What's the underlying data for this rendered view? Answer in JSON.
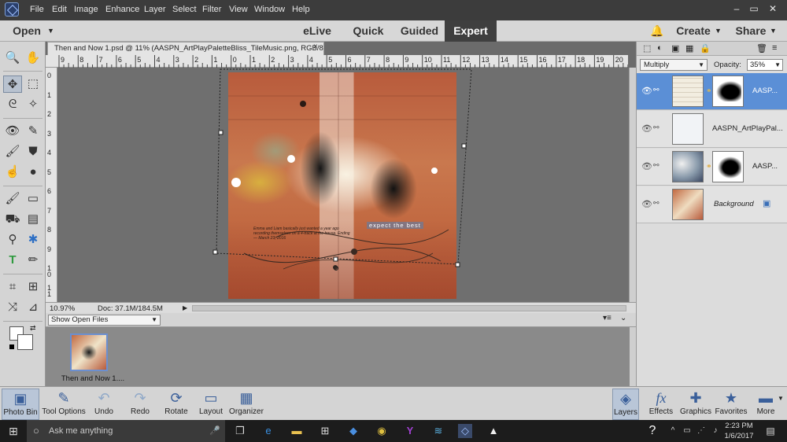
{
  "menubar": {
    "items": [
      "File",
      "Edit",
      "Image",
      "Enhance",
      "Layer",
      "Select",
      "Filter",
      "View",
      "Window",
      "Help"
    ],
    "window_controls": [
      "–",
      "▭",
      "✕"
    ]
  },
  "modebar": {
    "open_label": "Open",
    "modes": [
      "eLive",
      "Quick",
      "Guided",
      "Expert"
    ],
    "active_mode": "Expert",
    "create_label": "Create",
    "share_label": "Share"
  },
  "document": {
    "tab_title": "Then and Now 1.psd @ 11% (AASPN_ArtPlayPaletteBliss_TileMusic.png, RGB/8)",
    "close_glyph": "×",
    "zoom": "10.97%",
    "doc_size": "Doc: 37.1M/184.5M",
    "h_ruler_labels": [
      "9",
      "8",
      "7",
      "6",
      "5",
      "4",
      "3",
      "2",
      "1",
      "0",
      "1",
      "2",
      "3",
      "4",
      "5",
      "6",
      "7",
      "8",
      "9",
      "10",
      "11",
      "12",
      "13",
      "14",
      "15",
      "16",
      "17",
      "18",
      "19",
      "20"
    ],
    "v_ruler_labels": [
      "0",
      "1",
      "2",
      "3",
      "4",
      "5",
      "6",
      "7",
      "8",
      "9",
      "1 0",
      "1 1"
    ],
    "canvas_text": "expect the best",
    "journal_lines": [
      "Emma and Liam basically just wanted a year ago",
      "recording themselves on a 4-track at the house. Ending",
      "— March 23, 2016"
    ]
  },
  "photo_bin": {
    "dropdown_label": "Show Open Files",
    "thumb_label": "Then and Now 1...."
  },
  "layers_panel": {
    "blend_mode": "Multiply",
    "opacity_label": "Opacity:",
    "opacity_value": "35%",
    "layers": [
      {
        "name": "AASP...",
        "selected": true
      },
      {
        "name": "AASPN_ArtPlayPal...",
        "selected": false
      },
      {
        "name": "AASP...",
        "selected": false
      },
      {
        "name": "Background",
        "selected": false
      }
    ]
  },
  "bottombar": {
    "left": [
      {
        "label": "Photo Bin",
        "icon": "photo-bin-icon"
      },
      {
        "label": "Tool Options",
        "icon": "tool-options-icon"
      },
      {
        "label": "Undo",
        "icon": "undo-icon"
      },
      {
        "label": "Redo",
        "icon": "redo-icon"
      },
      {
        "label": "Rotate",
        "icon": "rotate-icon"
      },
      {
        "label": "Layout",
        "icon": "layout-icon"
      },
      {
        "label": "Organizer",
        "icon": "organizer-icon"
      }
    ],
    "right": [
      {
        "label": "Layers",
        "icon": "layers-icon"
      },
      {
        "label": "Effects",
        "icon": "effects-icon"
      },
      {
        "label": "Graphics",
        "icon": "graphics-icon"
      },
      {
        "label": "Favorites",
        "icon": "favorites-icon"
      },
      {
        "label": "More",
        "icon": "more-icon"
      }
    ]
  },
  "taskbar": {
    "search_placeholder": "Ask me anything",
    "time": "2:23 PM",
    "date": "1/6/2017"
  },
  "colors": {
    "selection_blue": "#5b8fd6",
    "mode_active": "#3f3f3f",
    "accent_icon": "#3a5f9a"
  }
}
